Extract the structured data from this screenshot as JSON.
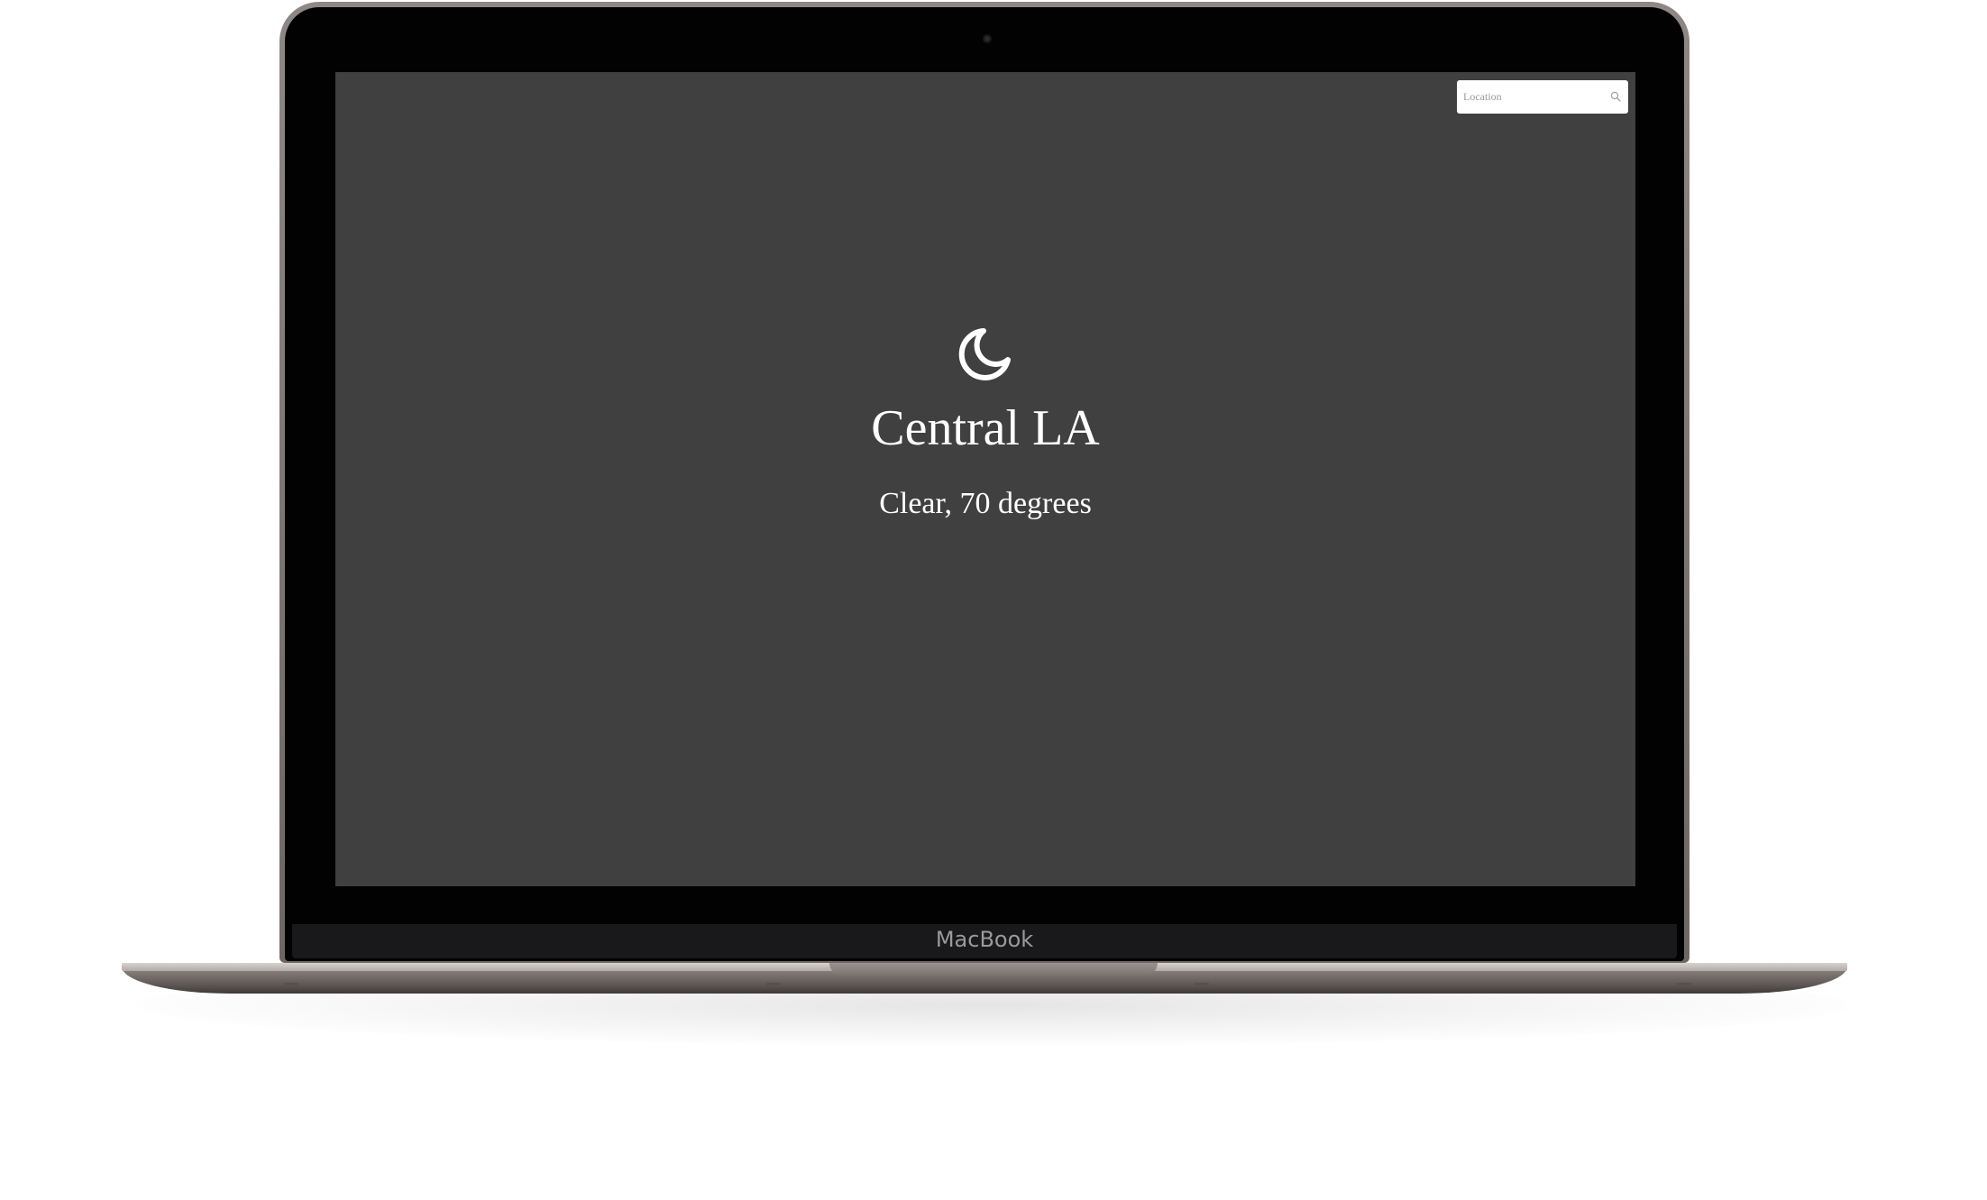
{
  "device": {
    "brand_label": "MacBook"
  },
  "search": {
    "placeholder": "Location",
    "icon": "search-icon"
  },
  "weather": {
    "icon": "moon-icon",
    "location": "Central LA",
    "conditions": "Clear, 70 degrees"
  },
  "colors": {
    "screen_background": "#404040",
    "text": "#ffffff",
    "search_background": "#ffffff"
  }
}
